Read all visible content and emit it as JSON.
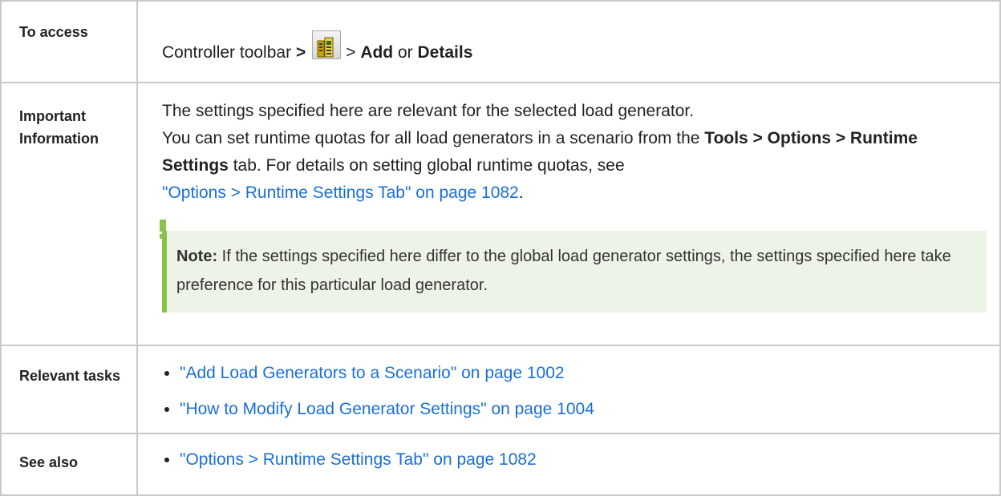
{
  "rows": {
    "access": {
      "label": "To access",
      "prefix": "Controller toolbar",
      "sep1": ">",
      "icon": "load-generators-icon",
      "sep2": ">",
      "add": "Add",
      "or": "or",
      "details": "Details"
    },
    "info": {
      "label": "Important Information",
      "line1": "The settings specified here are relevant for the selected load generator.",
      "line2_prefix": "You can set runtime quotas for all load generators in a scenario from the",
      "line2_bold": "Tools > Options > Runtime Settings",
      "line2_suffix": "tab. For details on setting global runtime quotas, see",
      "link": "\"Options > Runtime Settings Tab\" on page 1082",
      "link_end": ".",
      "note_label": "Note:",
      "note_text": "If the settings specified here differ to the global load generator settings, the settings specified here take preference for this particular load generator."
    },
    "tasks": {
      "label": "Relevant tasks",
      "items": [
        "\"Add Load Generators to a Scenario\" on page 1002",
        "\"How to Modify Load Generator Settings\" on page 1004"
      ]
    },
    "see_also": {
      "label": "See also",
      "items": [
        "\"Options > Runtime Settings Tab\" on page 1082"
      ]
    }
  },
  "colors": {
    "link": "#1a6fd6",
    "note_bg": "#eef3e8",
    "note_border": "#8bc34a",
    "table_border": "#c9c9c9"
  }
}
